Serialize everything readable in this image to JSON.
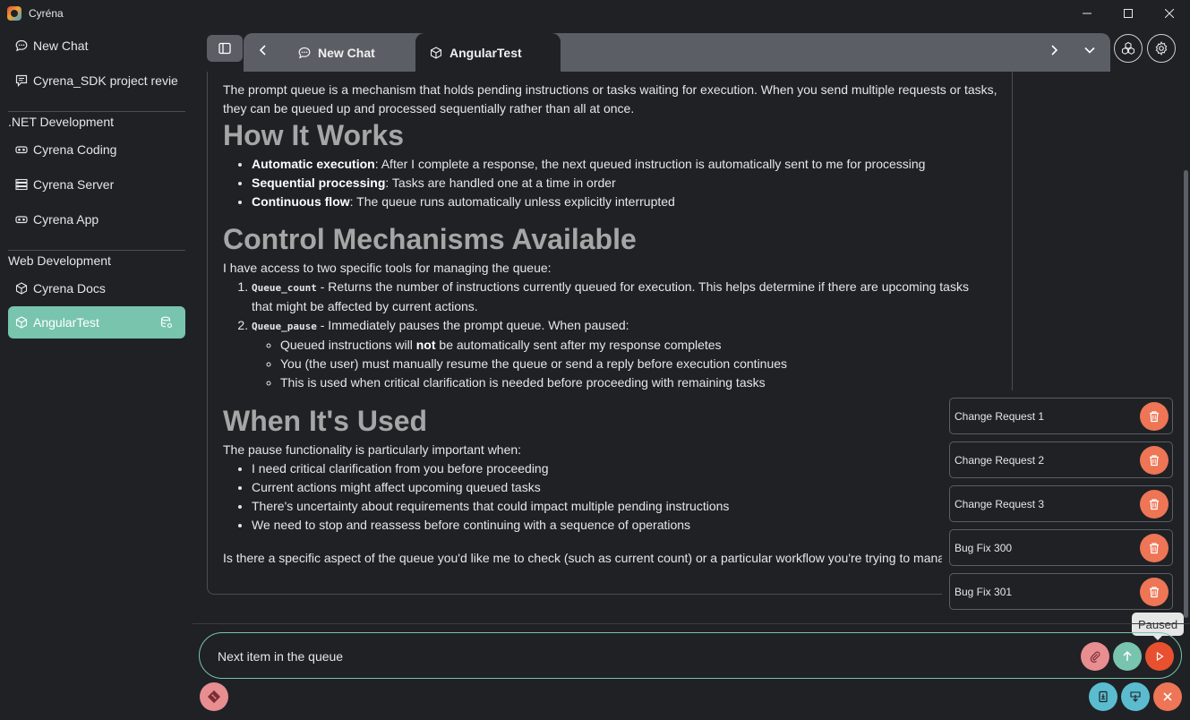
{
  "app": {
    "title": "Cyréna"
  },
  "sidebar": {
    "top_items": [
      {
        "label": "New Chat",
        "icon": "chat-bubble-icon"
      },
      {
        "label": "Cyrena_SDK project revie",
        "icon": "chat-bubble-text-icon"
      }
    ],
    "groups": [
      {
        "title": ".NET Development",
        "items": [
          {
            "label": "Cyrena Coding",
            "icon": "vr-goggles-icon"
          },
          {
            "label": "Cyrena Server",
            "icon": "server-icon"
          },
          {
            "label": "Cyrena App",
            "icon": "vr-goggles-icon"
          }
        ]
      },
      {
        "title": "Web Development",
        "items": [
          {
            "label": "Cyrena Docs",
            "icon": "box-icon"
          },
          {
            "label": "AngularTest",
            "icon": "box-icon",
            "active": true
          }
        ]
      }
    ]
  },
  "tabs": [
    {
      "label": "New Chat",
      "icon": "chat-bubble-icon",
      "active": false
    },
    {
      "label": "AngularTest",
      "icon": "box-icon",
      "active": true
    }
  ],
  "message": {
    "intro_1": "The prompt queue is a mechanism that holds pending instructions or tasks waiting for execution. When you send multiple requests or tasks,",
    "intro_2": "they can be queued up and processed sequentially rather than all at once.",
    "h_how": "How It Works",
    "how_items": [
      {
        "bold": "Automatic execution",
        "text": ": After I complete a response, the next queued instruction is automatically sent to me for processing"
      },
      {
        "bold": "Sequential processing",
        "text": ": Tasks are handled one at a time in order"
      },
      {
        "bold": "Continuous flow",
        "text": ": The queue runs automatically unless explicitly interrupted"
      }
    ],
    "h_control": "Control Mechanisms Available",
    "control_intro": "I have access to two specific tools for managing the queue:",
    "tool1_code": "Queue_count",
    "tool1_text": " - Returns the number of instructions currently queued for execution. This helps determine if there are upcoming tasks",
    "tool1_text2": "that might be affected by current actions.",
    "tool2_code": "Queue_pause",
    "tool2_text": " - Immediately pauses the prompt queue. When paused:",
    "sub1_pre": "Queued instructions will ",
    "sub1_bold": "not",
    "sub1_post": " be automatically sent after my response completes",
    "sub2": "You (the user) must manually resume the queue or send a reply before execution continues",
    "sub3": "This is used when critical clarification is needed before proceeding with remaining tasks",
    "h_when": "When It's Used",
    "when_intro": "The pause functionality is particularly important when:",
    "when_items": [
      "I need critical clarification from you before proceeding",
      "Current actions might affect upcoming queued tasks",
      "There's uncertainty about requirements that could impact multiple pending instructions",
      "We need to stop and reassess before continuing with a sequence of operations"
    ],
    "closing": "Is there a specific aspect of the queue you'd like me to check (such as current count) or a particular workflow you're trying to manag"
  },
  "queue": [
    "Change Request 1",
    "Change Request 2",
    "Change Request 3",
    "Bug Fix 300",
    "Bug Fix 301"
  ],
  "tooltip": "Paused",
  "input": {
    "value": "Next item in the queue"
  },
  "colors": {
    "accent": "#78c4ad",
    "danger": "#ee7555",
    "paused_red": "#e8502f",
    "attach_pink": "#e88e90",
    "secondary_blue": "#5bbcd0",
    "background": "#1f2125",
    "tab_bar": "#5b5e64"
  }
}
